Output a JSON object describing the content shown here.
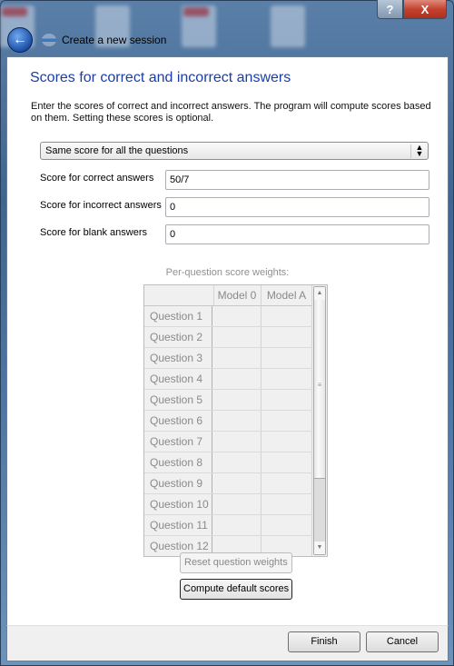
{
  "window": {
    "title": "Create a new session",
    "help_label": "?",
    "close_label": "X"
  },
  "page": {
    "heading": "Scores for correct and incorrect answers",
    "description": "Enter the scores of correct and incorrect answers. The program will compute scores based on them. Setting these scores is optional.",
    "mode_select": {
      "selected": "Same score for all the questions"
    },
    "fields": {
      "correct": {
        "label": "Score for correct answers",
        "value": "50/7"
      },
      "incorrect": {
        "label": "Score for incorrect answers",
        "value": "0"
      },
      "blank": {
        "label": "Score for blank answers",
        "value": "0"
      }
    },
    "weights_table": {
      "caption": "Per-question score weights:",
      "columns": [
        "Model 0",
        "Model A"
      ],
      "rows": [
        "Question 1",
        "Question 2",
        "Question 3",
        "Question 4",
        "Question 5",
        "Question 6",
        "Question 7",
        "Question 8",
        "Question 9",
        "Question 10",
        "Question 11",
        "Question 12"
      ]
    },
    "reset_button": "Reset question weights",
    "compute_button": "Compute default scores"
  },
  "footer": {
    "finish": "Finish",
    "cancel": "Cancel"
  }
}
